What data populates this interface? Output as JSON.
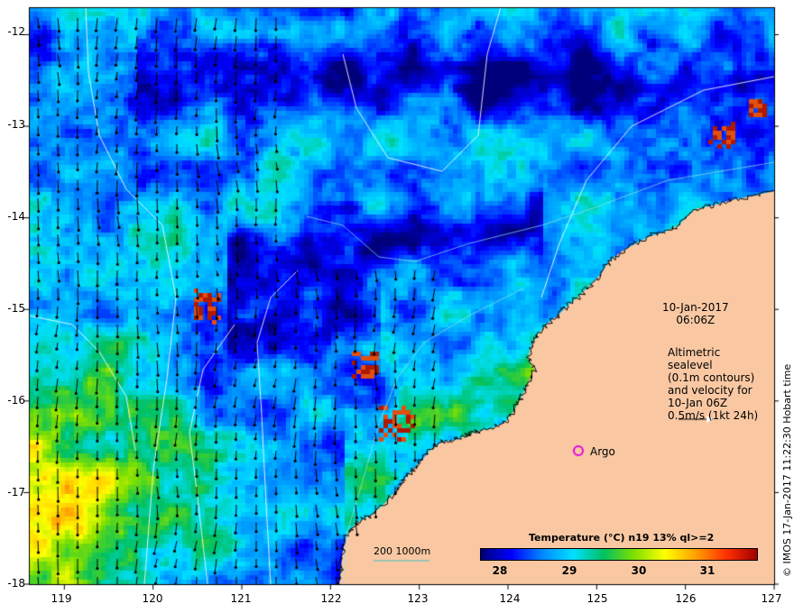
{
  "map": {
    "lon_range": [
      118.6,
      127
    ],
    "lat_range": [
      -18,
      -11.7
    ],
    "lon_ticks": [
      "119",
      "120",
      "121",
      "122",
      "123",
      "124",
      "125",
      "126",
      "127"
    ],
    "lat_ticks": [
      "-12",
      "-13",
      "-14",
      "-15",
      "-16",
      "-17",
      "-18"
    ],
    "land_color": "#f9c8a3",
    "argo_color": "#e600e6"
  },
  "annotations": {
    "date": "10-Jan-2017",
    "time": "06:06Z",
    "alti_line1": "Altimetric sealevel",
    "alti_line2": "(0.1m contours)",
    "alti_line3": "and velocity for",
    "alti_line4": "10-Jan 06Z",
    "alti_line5": "0.5m/s (1kt 24h)",
    "argo": "Argo",
    "contour_200": "200",
    "contour_1000": "1000m"
  },
  "colorbar": {
    "title": "Temperature (°C) n19 13% ql>=2",
    "range": [
      27.6,
      31.8
    ],
    "ticks": [
      "28",
      "29",
      "30",
      "31"
    ],
    "colors": [
      "#00007a",
      "#0000ff",
      "#0088ff",
      "#00e0ff",
      "#00c060",
      "#80e000",
      "#ffff00",
      "#ffa000",
      "#ff3000",
      "#a00000"
    ]
  },
  "credit": "© IMOS 17-Jan-2017 11:22:30 Hobart time"
}
